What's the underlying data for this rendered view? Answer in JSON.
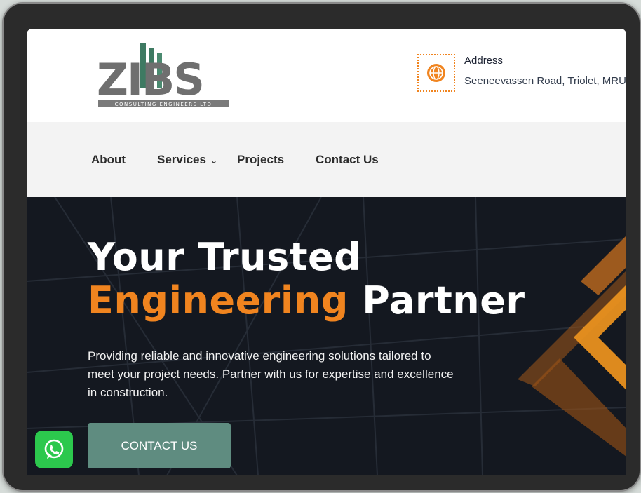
{
  "header": {
    "logo_text": "ZIBS",
    "logo_subtitle": "CONSULTING ENGINEERS LTD",
    "address_label": "Address",
    "address_value": "Seeneevassen Road, Triolet, MRU"
  },
  "nav": {
    "items": [
      {
        "label": "About"
      },
      {
        "label": "Services"
      },
      {
        "label": "Projects"
      },
      {
        "label": "Contact Us"
      }
    ]
  },
  "hero": {
    "title_line1": "Your Trusted",
    "title_accent": "Engineering",
    "title_rest": "Partner",
    "description": "Providing reliable and innovative engineering solutions tailored to meet your project needs. Partner with us for expertise and excellence in construction.",
    "cta_label": "CONTACT US"
  },
  "colors": {
    "accent": "#f0841f",
    "cta": "#5f8c80",
    "hero_bg": "#141820",
    "logo_grey": "#6f6f6f",
    "logo_green": "#3e7a62",
    "whatsapp": "#2cc84d"
  },
  "icons": {
    "address": "globe-icon",
    "chat": "whatsapp-icon",
    "dropdown": "chevron-down-icon"
  }
}
